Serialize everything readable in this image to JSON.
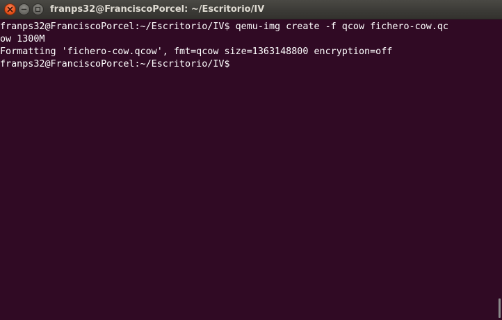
{
  "window": {
    "title": "franps32@FranciscoPorcel: ~/Escritorio/IV"
  },
  "terminal": {
    "lines": [
      "franps32@FranciscoPorcel:~/Escritorio/IV$ qemu-img create -f qcow fichero-cow.qc",
      "ow 1300M",
      "Formatting 'fichero-cow.qcow', fmt=qcow size=1363148800 encryption=off",
      "franps32@FranciscoPorcel:~/Escritorio/IV$ "
    ]
  },
  "colors": {
    "terminal_background": "#300a24",
    "terminal_text": "#ffffff",
    "titlebar": "#3c3b37",
    "close_button": "#e9541e"
  },
  "icons": {
    "close": "close-icon",
    "minimize": "minimize-icon",
    "maximize": "maximize-icon"
  }
}
